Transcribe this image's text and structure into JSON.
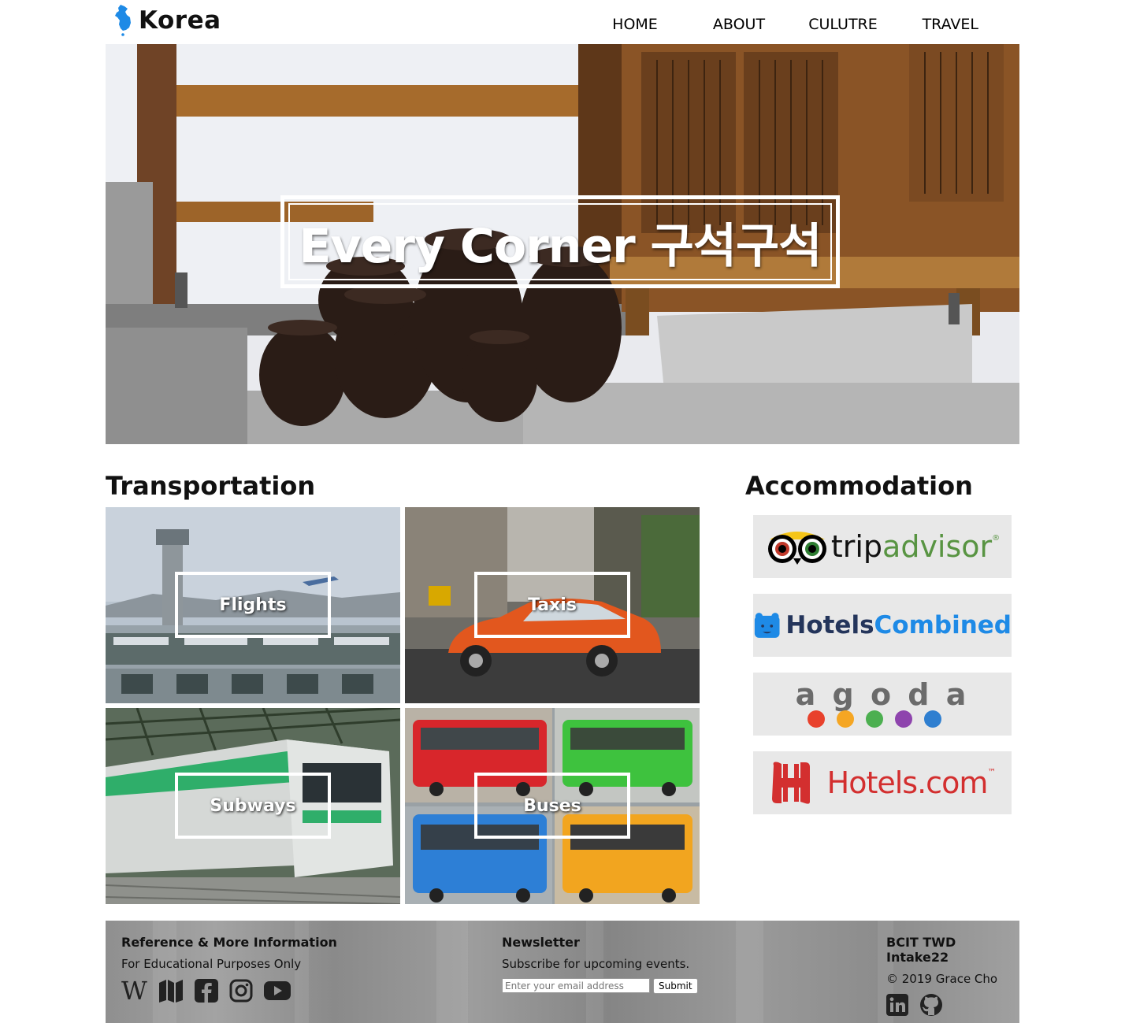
{
  "header": {
    "logo_text": "Korea",
    "nav": [
      "HOME",
      "ABOUT",
      "CULUTRE",
      "TRAVEL"
    ]
  },
  "hero": {
    "title": "Every Corner 구석구석"
  },
  "transportation": {
    "title": "Transportation",
    "tiles": [
      "Flights",
      "Taxis",
      "Subways",
      "Buses"
    ]
  },
  "accommodation": {
    "title": "Accommodation",
    "logos": [
      "tripadvisor",
      "HotelsCombined",
      "agoda",
      "Hotels.com"
    ],
    "tripadvisor_parts": [
      "trip",
      "advisor"
    ],
    "hotelscombined_parts": [
      "Hotels",
      "Combined"
    ],
    "agoda_letters": "a g o d a",
    "agoda_dot_colors": [
      "#e8412c",
      "#f5a623",
      "#4caf50",
      "#8e44ad",
      "#2f7fd0"
    ],
    "hotelscom_text": "Hotels.com",
    "tm_mark": "™"
  },
  "footer": {
    "col1": {
      "heading": "Reference & More Information",
      "text": "For Educational Purposes Only",
      "icons": [
        "wikipedia-icon",
        "map-icon",
        "facebook-icon",
        "instagram-icon",
        "youtube-icon"
      ]
    },
    "col2": {
      "heading": "Newsletter",
      "text": "Subscribe for upcoming events.",
      "email_placeholder": "Enter your email address",
      "submit_label": "Submit"
    },
    "col3": {
      "heading": "BCIT TWD Intake22",
      "text": "© 2019 Grace Cho",
      "icons": [
        "linkedin-icon",
        "github-icon"
      ]
    }
  },
  "colors": {
    "tripadvisor_green": "#589442",
    "hotelscombined_blue": "#1e8ae6",
    "hotelscombined_navy": "#24355b",
    "hotels_red": "#d32f2f"
  }
}
